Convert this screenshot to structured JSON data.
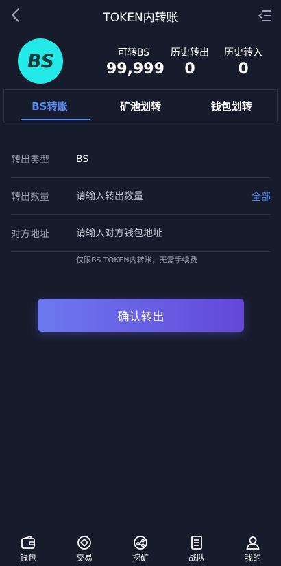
{
  "header": {
    "title": "TOKEN内转账",
    "back_icon": "chevron-left-icon",
    "menu_icon": "menu-list-icon"
  },
  "avatar": {
    "text": "BS"
  },
  "stats": [
    {
      "label": "可转BS",
      "value": "99,999"
    },
    {
      "label": "历史转出",
      "value": "0"
    },
    {
      "label": "历史转入",
      "value": "0"
    }
  ],
  "tabs": [
    {
      "label": "BS转账",
      "active": true
    },
    {
      "label": "矿池划转",
      "active": false
    },
    {
      "label": "钱包划转",
      "active": false
    }
  ],
  "form": {
    "type_label": "转出类型",
    "type_value": "BS",
    "amount_label": "转出数量",
    "amount_placeholder": "请输入转出数量",
    "all_label": "全部",
    "address_label": "对方地址",
    "address_placeholder": "请输入对方钱包地址",
    "note": "仅限BS TOKEN内转账，无需手续费"
  },
  "confirm_label": "确认转出",
  "nav": [
    {
      "label": "钱包",
      "icon": "wallet-icon"
    },
    {
      "label": "交易",
      "icon": "exchange-icon"
    },
    {
      "label": "挖矿",
      "icon": "mining-icon"
    },
    {
      "label": "战队",
      "icon": "team-icon"
    },
    {
      "label": "我的",
      "icon": "user-icon"
    }
  ],
  "colors": {
    "background": "#161c2b",
    "accent": "#5b8cf6",
    "avatar": "#23e9e9",
    "button_start": "#6c79f0",
    "button_end": "#6348d8"
  }
}
